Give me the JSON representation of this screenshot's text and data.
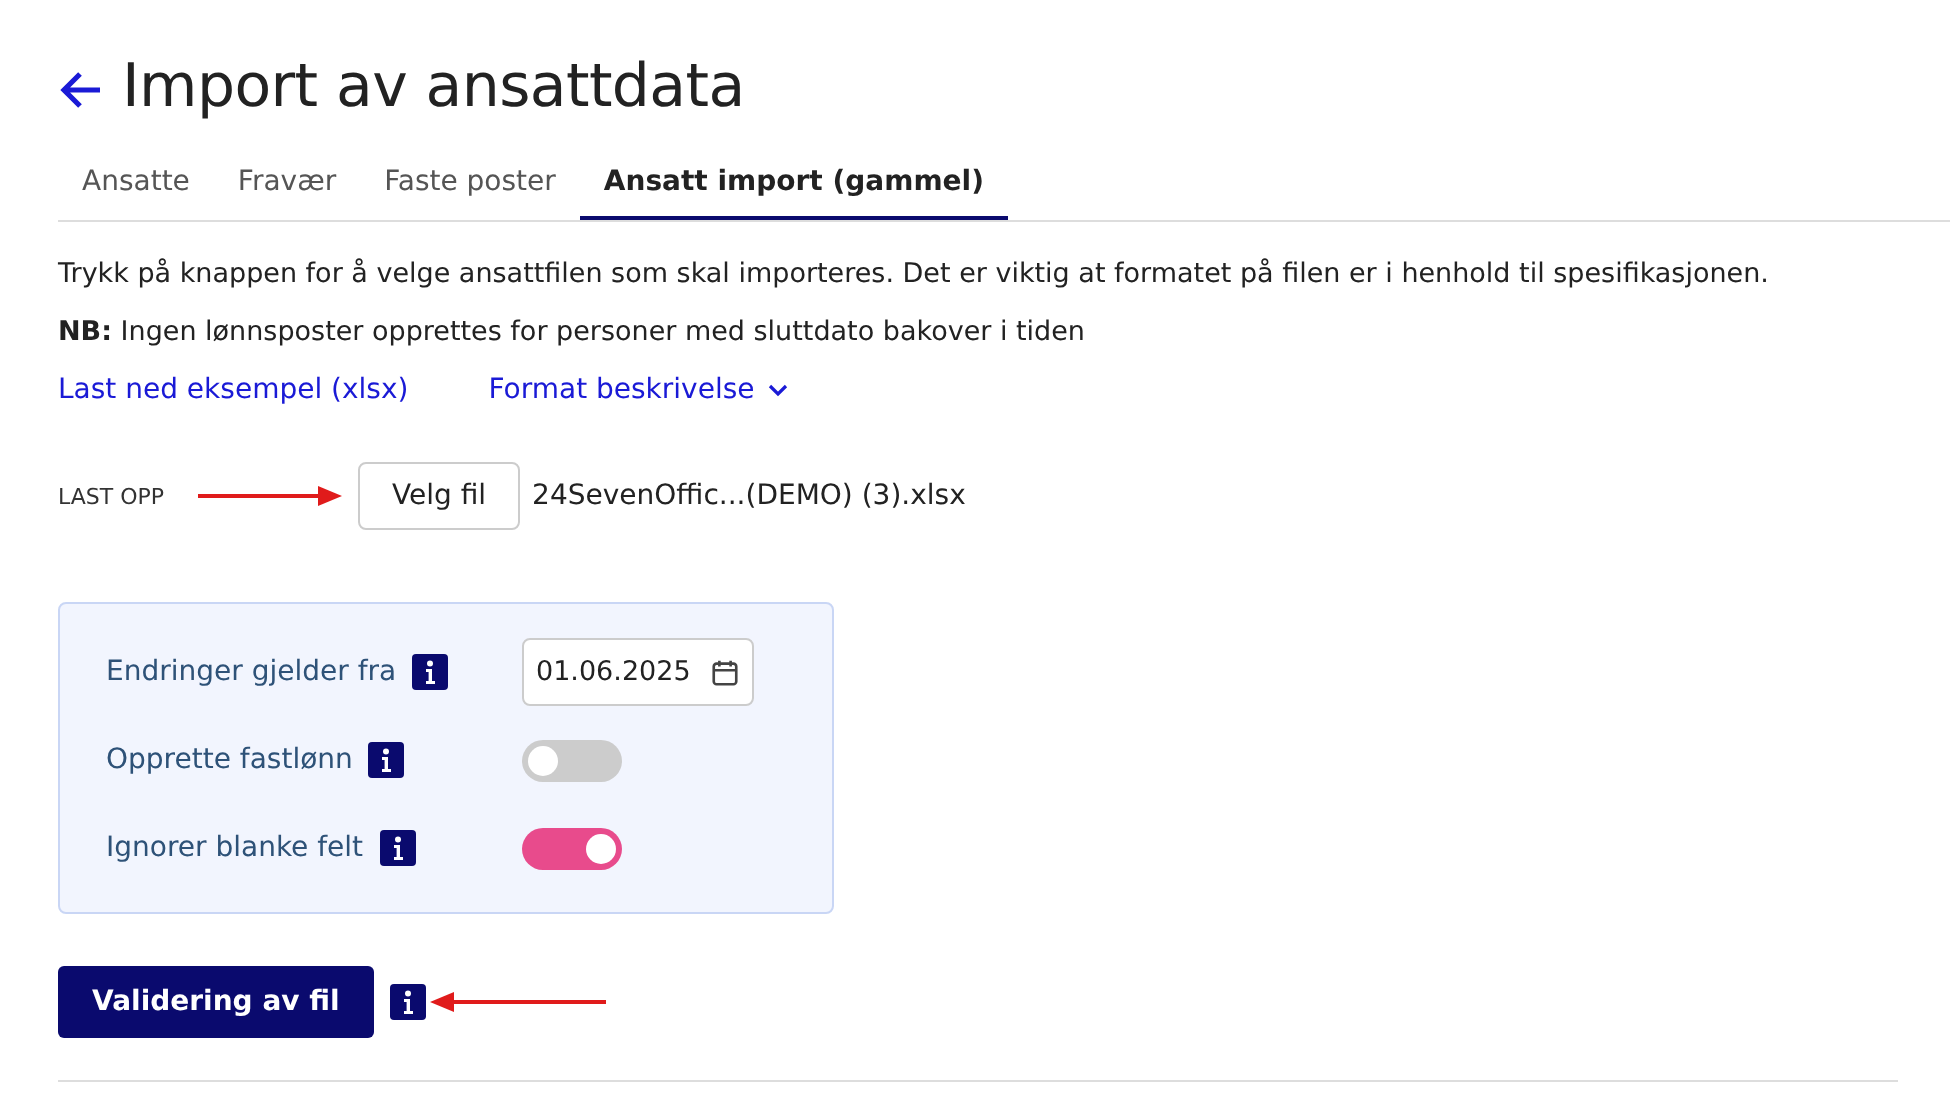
{
  "page": {
    "title": "Import av ansattdata"
  },
  "tabs": [
    {
      "label": "Ansatte",
      "selected": false
    },
    {
      "label": "Fravær",
      "selected": false
    },
    {
      "label": "Faste poster",
      "selected": false
    },
    {
      "label": "Ansatt import (gammel)",
      "selected": true
    }
  ],
  "intro": "Trykk på knappen for å velge ansattfilen som skal importeres. Det er viktig at formatet på filen er i henhold til spesifikasjonen.",
  "note": "**NB:** Ingen lønnsposter opprettes for personer med sluttdato bakover i tiden",
  "links": [
    {
      "label": "Last ned eksempel (xlsx)",
      "kind": "link"
    },
    {
      "label": "Format beskrivelse",
      "kind": "dropdown"
    }
  ],
  "upload": {
    "label": "LAST OPP",
    "button": "Velg fil",
    "file": "24SevenOffic...(DEMO) (3).xlsx"
  },
  "settings": [
    {
      "kind": "date",
      "label": "Endringer gjelder fra",
      "value": "01.06.2025"
    },
    {
      "kind": "toggle",
      "label": "Opprette fastlønn",
      "on": false
    },
    {
      "kind": "toggle",
      "label": "Ignorer blanke felt",
      "on": true
    }
  ],
  "validate_button": "Validering av fil"
}
